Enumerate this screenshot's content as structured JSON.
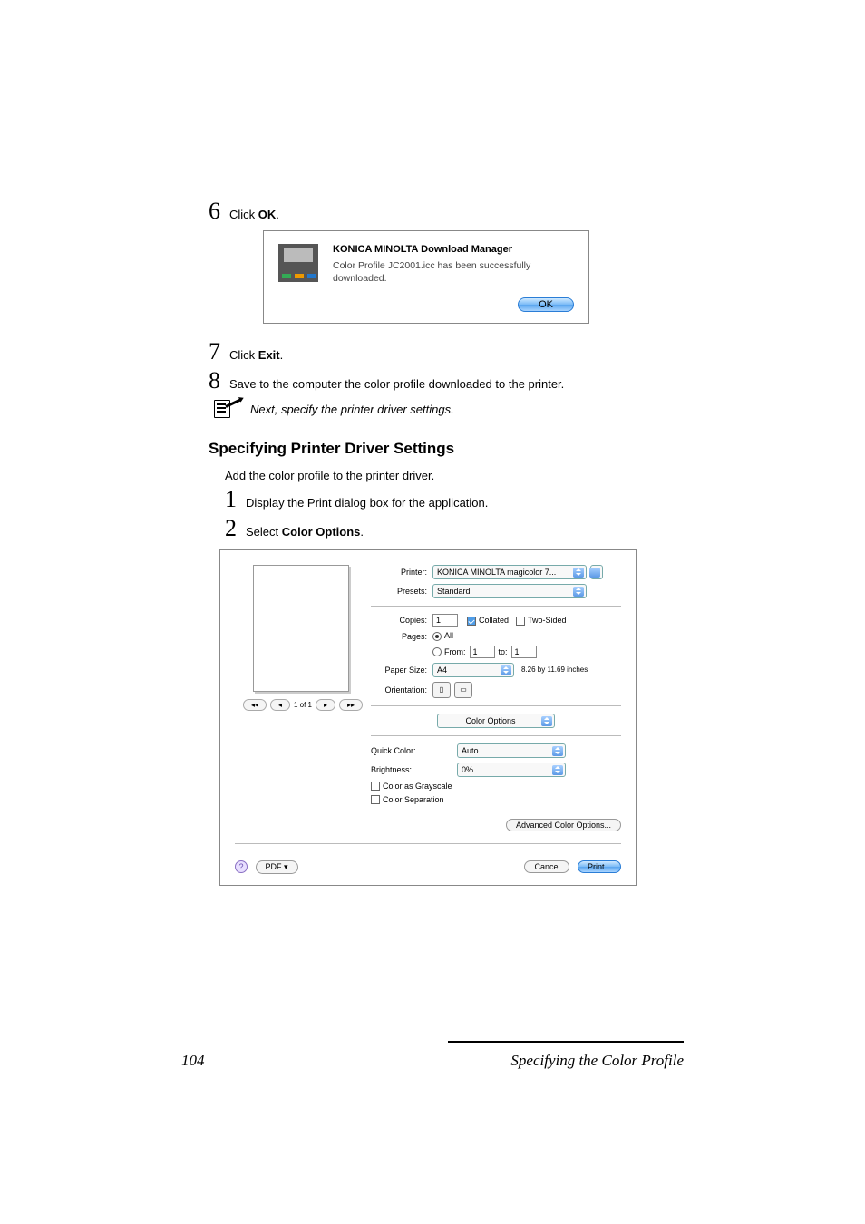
{
  "steps": {
    "s6": {
      "num": "6",
      "prefix": "Click ",
      "bold": "OK",
      "suffix": "."
    },
    "s7": {
      "num": "7",
      "prefix": "Click ",
      "bold": "Exit",
      "suffix": "."
    },
    "s8": {
      "num": "8",
      "text": "Save to the computer the color profile downloaded to the printer."
    }
  },
  "dialog1": {
    "title": "KONICA MINOLTA Download Manager",
    "message": "Color Profile JC2001.icc has been successfully downloaded.",
    "ok": "OK"
  },
  "note": "Next, specify the printer driver settings.",
  "section_heading": "Specifying Printer Driver Settings",
  "intro": "Add the color profile to the printer driver.",
  "steps2": {
    "s1": {
      "num": "1",
      "text": "Display the Print dialog box for the application."
    },
    "s2": {
      "num": "2",
      "prefix": "Select ",
      "bold": "Color Options",
      "suffix": "."
    }
  },
  "print_dialog": {
    "printer_label": "Printer:",
    "printer_value": "KONICA MINOLTA magicolor 7...",
    "presets_label": "Presets:",
    "presets_value": "Standard",
    "copies_label": "Copies:",
    "copies_value": "1",
    "collated": "Collated",
    "two_sided": "Two-Sided",
    "pages_label": "Pages:",
    "pages_all": "All",
    "pages_from": "From:",
    "pages_from_val": "1",
    "pages_to": "to:",
    "pages_to_val": "1",
    "paper_size_label": "Paper Size:",
    "paper_size_value": "A4",
    "paper_size_dim": "8.26 by 11.69 inches",
    "orientation_label": "Orientation:",
    "panel_select": "Color Options",
    "quick_color_label": "Quick Color:",
    "quick_color_value": "Auto",
    "brightness_label": "Brightness:",
    "brightness_value": "0%",
    "grayscale": "Color as Grayscale",
    "separation": "Color Separation",
    "advanced_btn": "Advanced Color Options...",
    "page_indicator": "1 of 1",
    "pdf_btn": "PDF ▾",
    "cancel": "Cancel",
    "print": "Print..."
  },
  "footer": {
    "page_number": "104",
    "title": "Specifying the Color Profile"
  }
}
